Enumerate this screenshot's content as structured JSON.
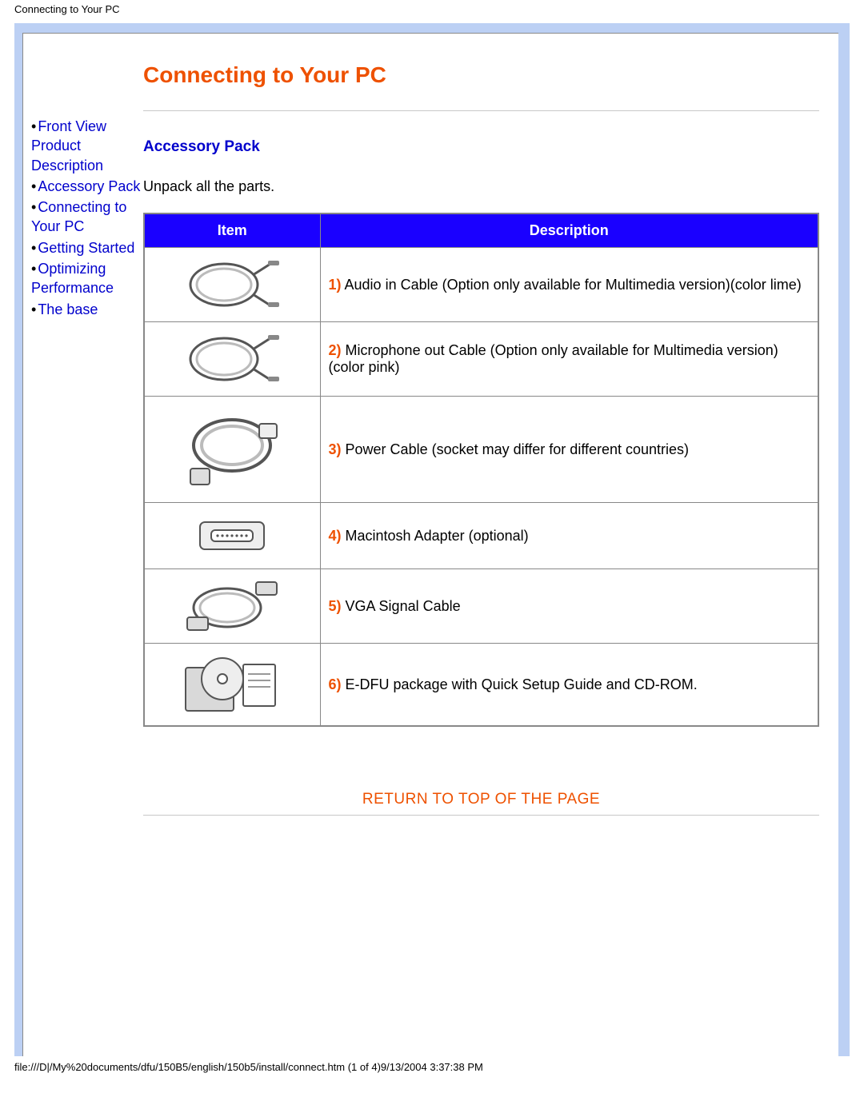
{
  "browser_title": "Connecting to Your PC",
  "page_title": "Connecting to Your PC",
  "sidebar": {
    "items": [
      {
        "label": "Front View Product Description"
      },
      {
        "label": "Accessory Pack"
      },
      {
        "label": "Connecting to Your PC"
      },
      {
        "label": "Getting Started"
      },
      {
        "label": "Optimizing Performance"
      },
      {
        "label": "The base"
      }
    ]
  },
  "section": {
    "heading": "Accessory Pack",
    "intro": "Unpack all the parts.",
    "table": {
      "headers": {
        "item": "Item",
        "desc": "Description"
      },
      "rows": [
        {
          "num": "1)",
          "desc": "Audio in Cable (Option only available for Multimedia version)(color lime)",
          "icon": "audio-cable-icon"
        },
        {
          "num": "2)",
          "desc": "Microphone out Cable (Option only available for Multimedia version)(color pink)",
          "icon": "mic-cable-icon"
        },
        {
          "num": "3)",
          "desc": "Power Cable (socket may differ for different countries)",
          "icon": "power-cable-icon"
        },
        {
          "num": "4)",
          "desc": "Macintosh Adapter (optional)",
          "icon": "mac-adapter-icon"
        },
        {
          "num": "5)",
          "desc": "VGA Signal Cable",
          "icon": "vga-cable-icon"
        },
        {
          "num": "6)",
          "desc": "E-DFU package with Quick Setup Guide and CD-ROM.",
          "icon": "edfu-package-icon"
        }
      ]
    }
  },
  "return_link": "RETURN TO TOP OF THE PAGE",
  "footer_path": "file:///D|/My%20documents/dfu/150B5/english/150b5/install/connect.htm (1 of 4)9/13/2004 3:37:38 PM"
}
